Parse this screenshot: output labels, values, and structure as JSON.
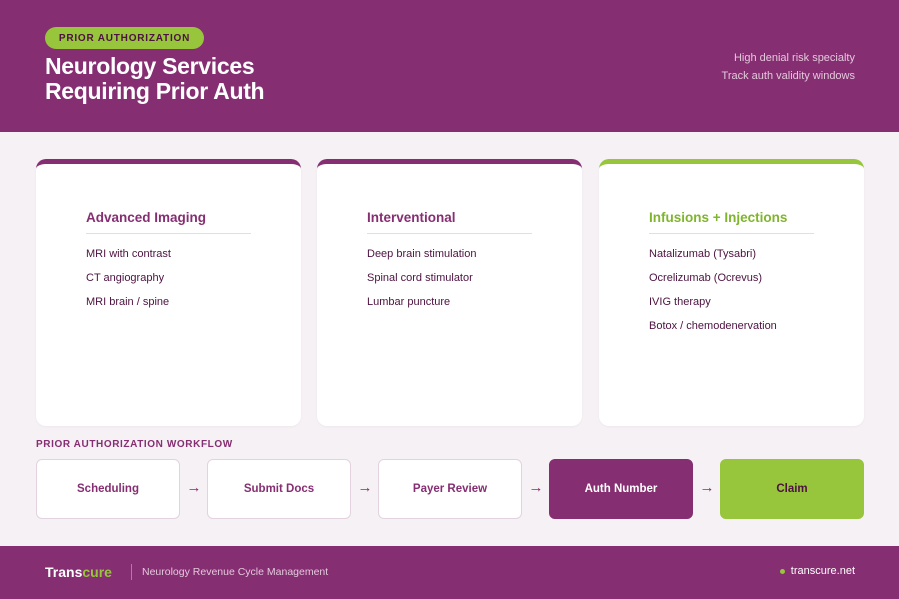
{
  "header": {
    "badge": "PRIOR AUTHORIZATION",
    "title_line1": "Neurology Services",
    "title_line2": "Requiring Prior Auth",
    "note1": "High denial risk specialty",
    "note2": "Track auth validity windows"
  },
  "cards": [
    {
      "title": "Advanced Imaging",
      "items": [
        "MRI with contrast",
        "CT angiography",
        "MRI brain / spine"
      ]
    },
    {
      "title": "Interventional",
      "items": [
        "Deep brain stimulation",
        "Spinal cord stimulator",
        "Lumbar puncture"
      ]
    },
    {
      "title": "Infusions + Injections",
      "items": [
        "Natalizumab (Tysabri)",
        "Ocrelizumab (Ocrevus)",
        "IVIG therapy",
        "Botox / chemodenervation"
      ]
    }
  ],
  "workflow": {
    "label": "PRIOR AUTHORIZATION WORKFLOW",
    "arrow": "→",
    "steps": [
      "Scheduling",
      "Submit Docs",
      "Payer Review",
      "Auth Number",
      "Claim"
    ]
  },
  "footer": {
    "brand_main": "Trans",
    "brand_accent": "cure",
    "subtitle": "Neurology Revenue Cycle Management",
    "site": "transcure.net"
  },
  "colors": {
    "primary": "#862e72",
    "accent": "#97c53c",
    "background": "#f6f1f5"
  }
}
